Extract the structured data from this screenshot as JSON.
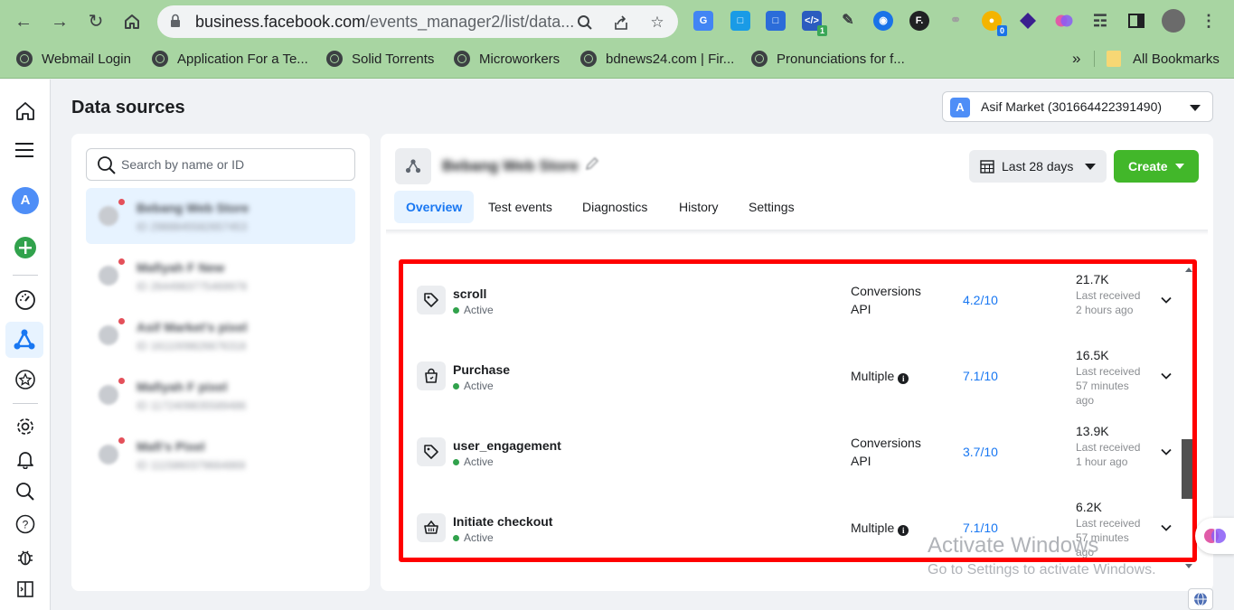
{
  "browser": {
    "url_host": "business.facebook.com",
    "url_path": "/events_manager2/list/data...",
    "extension_badge_1": "1",
    "extension_badge_2": "0",
    "ext_f_label": "F.",
    "bookmarks": [
      {
        "label": "Webmail Login"
      },
      {
        "label": "Application For a Te..."
      },
      {
        "label": "Solid Torrents"
      },
      {
        "label": "Microworkers"
      },
      {
        "label": "bdnews24.com | Fir..."
      },
      {
        "label": "Pronunciations for f..."
      }
    ],
    "bookmarks_overflow": "»",
    "all_bookmarks": "All Bookmarks"
  },
  "rail": {
    "account_initial": "A"
  },
  "page": {
    "title": "Data sources",
    "account": {
      "initial": "A",
      "label": "Asif Market (301664422391490)"
    }
  },
  "list_panel": {
    "search_placeholder": "Search by name or ID",
    "sources": [
      {
        "name": "Bebang Web Store",
        "id": "ID 2988845582657453"
      },
      {
        "name": "Mafiyah F New",
        "id": "ID 2644983775469978"
      },
      {
        "name": "Asif Market's pixel",
        "id": "ID 1611009826676318"
      },
      {
        "name": "Mafiyah F pixel",
        "id": "ID 1172409835589486"
      },
      {
        "name": "Mafi's Pixel",
        "id": "ID 1115860379664869"
      }
    ]
  },
  "detail": {
    "source_name": "Bebang Web Store",
    "date_range": "Last 28 days",
    "create_label": "Create",
    "tabs": [
      {
        "label": "Overview"
      },
      {
        "label": "Test events"
      },
      {
        "label": "Diagnostics"
      },
      {
        "label": "History"
      },
      {
        "label": "Settings"
      }
    ]
  },
  "events": [
    {
      "name": "scroll",
      "status": "Active",
      "integration": "Conversions API",
      "score": "4.2/10",
      "count": "21.7K",
      "last": "Last received 2 hours ago",
      "icon": "tag-icon"
    },
    {
      "name": "Purchase",
      "status": "Active",
      "integration": "Multiple",
      "score": "7.1/10",
      "count": "16.5K",
      "last": "Last received 57 minutes ago",
      "icon": "shopping-bag-icon"
    },
    {
      "name": "user_engagement",
      "status": "Active",
      "integration": "Conversions API",
      "score": "3.7/10",
      "count": "13.9K",
      "last": "Last received 1 hour ago",
      "icon": "tag-icon"
    },
    {
      "name": "Initiate checkout",
      "status": "Active",
      "integration": "Multiple",
      "score": "7.1/10",
      "count": "6.2K",
      "last": "Last received 57 minutes ago",
      "icon": "basket-icon"
    }
  ],
  "watermark": {
    "line1": "Activate Windows",
    "line2": "Go to Settings to activate Windows."
  },
  "colors": {
    "chrome": "#a8d5a2",
    "accent": "#1877f2",
    "create": "#42b72a",
    "highlight": "#ff0000",
    "active_dot": "#31a24c"
  }
}
